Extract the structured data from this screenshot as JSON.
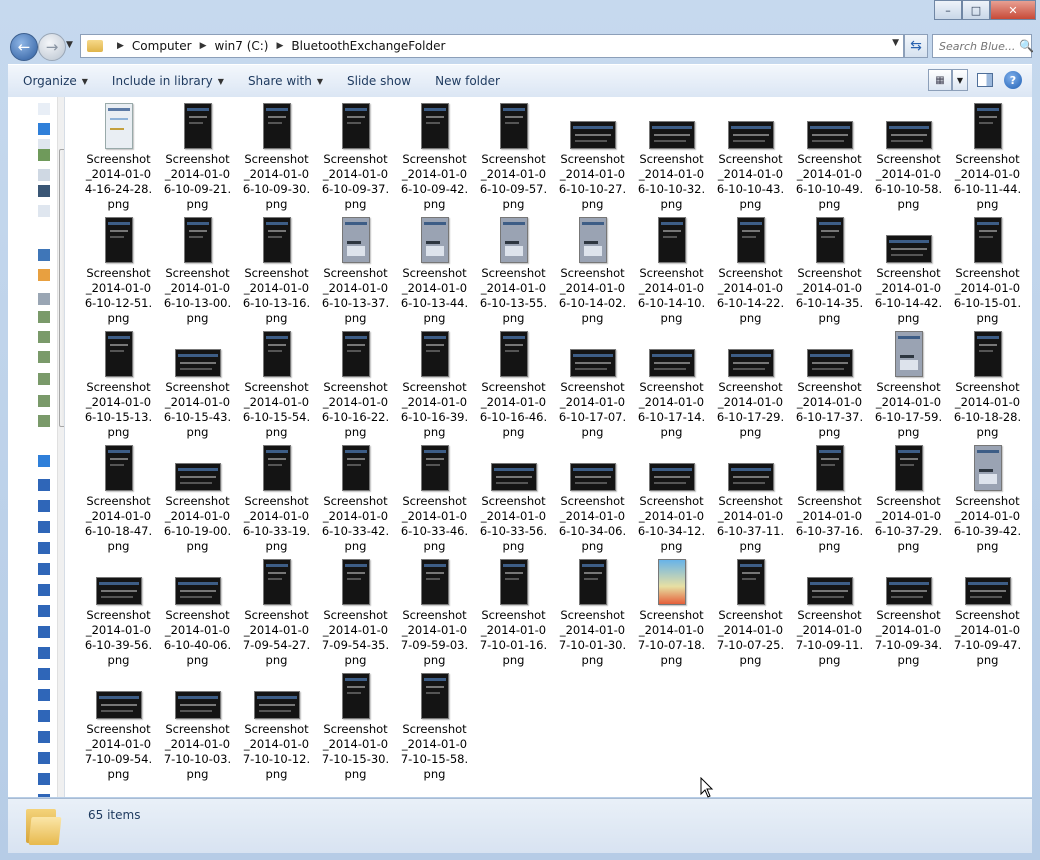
{
  "window": {
    "caption_buttons": [
      "minimize",
      "maximize",
      "close"
    ]
  },
  "address": {
    "path": [
      "Computer",
      "win7 (C:)",
      "BluetoothExchangeFolder"
    ],
    "search_placeholder": "Search Blue..."
  },
  "toolbar": {
    "items": [
      {
        "label": "Organize",
        "dropdown": true
      },
      {
        "label": "Include in library",
        "dropdown": true
      },
      {
        "label": "Share with",
        "dropdown": true
      },
      {
        "label": "Slide show",
        "dropdown": false
      },
      {
        "label": "New folder",
        "dropdown": false
      }
    ],
    "help": "?"
  },
  "files": [
    {
      "line1": "Screenshot",
      "line2": "_2014-01-0",
      "line3": "4-16-24-28.",
      "line4": "png",
      "thumb": "map"
    },
    {
      "line1": "Screenshot",
      "line2": "_2014-01-0",
      "line3": "6-10-09-21.",
      "line4": "png",
      "thumb": "p"
    },
    {
      "line1": "Screenshot",
      "line2": "_2014-01-0",
      "line3": "6-10-09-30.",
      "line4": "png",
      "thumb": "p"
    },
    {
      "line1": "Screenshot",
      "line2": "_2014-01-0",
      "line3": "6-10-09-37.",
      "line4": "png",
      "thumb": "p"
    },
    {
      "line1": "Screenshot",
      "line2": "_2014-01-0",
      "line3": "6-10-09-42.",
      "line4": "png",
      "thumb": "p"
    },
    {
      "line1": "Screenshot",
      "line2": "_2014-01-0",
      "line3": "6-10-09-57.",
      "line4": "png",
      "thumb": "p"
    },
    {
      "line1": "Screenshot",
      "line2": "_2014-01-0",
      "line3": "6-10-10-27.",
      "line4": "png",
      "thumb": "l"
    },
    {
      "line1": "Screenshot",
      "line2": "_2014-01-0",
      "line3": "6-10-10-32.",
      "line4": "png",
      "thumb": "l"
    },
    {
      "line1": "Screenshot",
      "line2": "_2014-01-0",
      "line3": "6-10-10-43.",
      "line4": "png",
      "thumb": "l"
    },
    {
      "line1": "Screenshot",
      "line2": "_2014-01-0",
      "line3": "6-10-10-49.",
      "line4": "png",
      "thumb": "l"
    },
    {
      "line1": "Screenshot",
      "line2": "_2014-01-0",
      "line3": "6-10-10-58.",
      "line4": "png",
      "thumb": "l"
    },
    {
      "line1": "Screenshot",
      "line2": "_2014-01-0",
      "line3": "6-10-11-44.",
      "line4": "png",
      "thumb": "p"
    },
    {
      "line1": "Screenshot",
      "line2": "_2014-01-0",
      "line3": "6-10-12-51.",
      "line4": "png",
      "thumb": "p"
    },
    {
      "line1": "Screenshot",
      "line2": "_2014-01-0",
      "line3": "6-10-13-00.",
      "line4": "png",
      "thumb": "p"
    },
    {
      "line1": "Screenshot",
      "line2": "_2014-01-0",
      "line3": "6-10-13-16.",
      "line4": "png",
      "thumb": "p"
    },
    {
      "line1": "Screenshot",
      "line2": "_2014-01-0",
      "line3": "6-10-13-37.",
      "line4": "png",
      "thumb": "kb"
    },
    {
      "line1": "Screenshot",
      "line2": "_2014-01-0",
      "line3": "6-10-13-44.",
      "line4": "png",
      "thumb": "kb"
    },
    {
      "line1": "Screenshot",
      "line2": "_2014-01-0",
      "line3": "6-10-13-55.",
      "line4": "png",
      "thumb": "kb"
    },
    {
      "line1": "Screenshot",
      "line2": "_2014-01-0",
      "line3": "6-10-14-02.",
      "line4": "png",
      "thumb": "kb"
    },
    {
      "line1": "Screenshot",
      "line2": "_2014-01-0",
      "line3": "6-10-14-10.",
      "line4": "png",
      "thumb": "p"
    },
    {
      "line1": "Screenshot",
      "line2": "_2014-01-0",
      "line3": "6-10-14-22.",
      "line4": "png",
      "thumb": "p"
    },
    {
      "line1": "Screenshot",
      "line2": "_2014-01-0",
      "line3": "6-10-14-35.",
      "line4": "png",
      "thumb": "p"
    },
    {
      "line1": "Screenshot",
      "line2": "_2014-01-0",
      "line3": "6-10-14-42.",
      "line4": "png",
      "thumb": "l"
    },
    {
      "line1": "Screenshot",
      "line2": "_2014-01-0",
      "line3": "6-10-15-01.",
      "line4": "png",
      "thumb": "p"
    },
    {
      "line1": "Screenshot",
      "line2": "_2014-01-0",
      "line3": "6-10-15-13.",
      "line4": "png",
      "thumb": "p"
    },
    {
      "line1": "Screenshot",
      "line2": "_2014-01-0",
      "line3": "6-10-15-43.",
      "line4": "png",
      "thumb": "l"
    },
    {
      "line1": "Screenshot",
      "line2": "_2014-01-0",
      "line3": "6-10-15-54.",
      "line4": "png",
      "thumb": "p"
    },
    {
      "line1": "Screenshot",
      "line2": "_2014-01-0",
      "line3": "6-10-16-22.",
      "line4": "png",
      "thumb": "p"
    },
    {
      "line1": "Screenshot",
      "line2": "_2014-01-0",
      "line3": "6-10-16-39.",
      "line4": "png",
      "thumb": "p"
    },
    {
      "line1": "Screenshot",
      "line2": "_2014-01-0",
      "line3": "6-10-16-46.",
      "line4": "png",
      "thumb": "p"
    },
    {
      "line1": "Screenshot",
      "line2": "_2014-01-0",
      "line3": "6-10-17-07.",
      "line4": "png",
      "thumb": "l"
    },
    {
      "line1": "Screenshot",
      "line2": "_2014-01-0",
      "line3": "6-10-17-14.",
      "line4": "png",
      "thumb": "l"
    },
    {
      "line1": "Screenshot",
      "line2": "_2014-01-0",
      "line3": "6-10-17-29.",
      "line4": "png",
      "thumb": "l"
    },
    {
      "line1": "Screenshot",
      "line2": "_2014-01-0",
      "line3": "6-10-17-37.",
      "line4": "png",
      "thumb": "l"
    },
    {
      "line1": "Screenshot",
      "line2": "_2014-01-0",
      "line3": "6-10-17-59.",
      "line4": "png",
      "thumb": "kb"
    },
    {
      "line1": "Screenshot",
      "line2": "_2014-01-0",
      "line3": "6-10-18-28.",
      "line4": "png",
      "thumb": "p"
    },
    {
      "line1": "Screenshot",
      "line2": "_2014-01-0",
      "line3": "6-10-18-47.",
      "line4": "png",
      "thumb": "p"
    },
    {
      "line1": "Screenshot",
      "line2": "_2014-01-0",
      "line3": "6-10-19-00.",
      "line4": "png",
      "thumb": "l"
    },
    {
      "line1": "Screenshot",
      "line2": "_2014-01-0",
      "line3": "6-10-33-19.",
      "line4": "png",
      "thumb": "p"
    },
    {
      "line1": "Screenshot",
      "line2": "_2014-01-0",
      "line3": "6-10-33-42.",
      "line4": "png",
      "thumb": "p"
    },
    {
      "line1": "Screenshot",
      "line2": "_2014-01-0",
      "line3": "6-10-33-46.",
      "line4": "png",
      "thumb": "p"
    },
    {
      "line1": "Screenshot",
      "line2": "_2014-01-0",
      "line3": "6-10-33-56.",
      "line4": "png",
      "thumb": "l"
    },
    {
      "line1": "Screenshot",
      "line2": "_2014-01-0",
      "line3": "6-10-34-06.",
      "line4": "png",
      "thumb": "l"
    },
    {
      "line1": "Screenshot",
      "line2": "_2014-01-0",
      "line3": "6-10-34-12.",
      "line4": "png",
      "thumb": "l"
    },
    {
      "line1": "Screenshot",
      "line2": "_2014-01-0",
      "line3": "6-10-37-11.",
      "line4": "png",
      "thumb": "l"
    },
    {
      "line1": "Screenshot",
      "line2": "_2014-01-0",
      "line3": "6-10-37-16.",
      "line4": "png",
      "thumb": "p"
    },
    {
      "line1": "Screenshot",
      "line2": "_2014-01-0",
      "line3": "6-10-37-29.",
      "line4": "png",
      "thumb": "p"
    },
    {
      "line1": "Screenshot",
      "line2": "_2014-01-0",
      "line3": "6-10-39-42.",
      "line4": "png",
      "thumb": "kb"
    },
    {
      "line1": "Screenshot",
      "line2": "_2014-01-0",
      "line3": "6-10-39-56.",
      "line4": "png",
      "thumb": "l"
    },
    {
      "line1": "Screenshot",
      "line2": "_2014-01-0",
      "line3": "6-10-40-06.",
      "line4": "png",
      "thumb": "l"
    },
    {
      "line1": "Screenshot",
      "line2": "_2014-01-0",
      "line3": "7-09-54-27.",
      "line4": "png",
      "thumb": "p"
    },
    {
      "line1": "Screenshot",
      "line2": "_2014-01-0",
      "line3": "7-09-54-35.",
      "line4": "png",
      "thumb": "p"
    },
    {
      "line1": "Screenshot",
      "line2": "_2014-01-0",
      "line3": "7-09-59-03.",
      "line4": "png",
      "thumb": "p"
    },
    {
      "line1": "Screenshot",
      "line2": "_2014-01-0",
      "line3": "7-10-01-16.",
      "line4": "png",
      "thumb": "p"
    },
    {
      "line1": "Screenshot",
      "line2": "_2014-01-0",
      "line3": "7-10-01-30.",
      "line4": "png",
      "thumb": "p"
    },
    {
      "line1": "Screenshot",
      "line2": "_2014-01-0",
      "line3": "7-10-07-18.",
      "line4": "png",
      "thumb": "home"
    },
    {
      "line1": "Screenshot",
      "line2": "_2014-01-0",
      "line3": "7-10-07-25.",
      "line4": "png",
      "thumb": "p"
    },
    {
      "line1": "Screenshot",
      "line2": "_2014-01-0",
      "line3": "7-10-09-11.",
      "line4": "png",
      "thumb": "l"
    },
    {
      "line1": "Screenshot",
      "line2": "_2014-01-0",
      "line3": "7-10-09-34.",
      "line4": "png",
      "thumb": "l"
    },
    {
      "line1": "Screenshot",
      "line2": "_2014-01-0",
      "line3": "7-10-09-47.",
      "line4": "png",
      "thumb": "l"
    },
    {
      "line1": "Screenshot",
      "line2": "_2014-01-0",
      "line3": "7-10-09-54.",
      "line4": "png",
      "thumb": "l"
    },
    {
      "line1": "Screenshot",
      "line2": "_2014-01-0",
      "line3": "7-10-10-03.",
      "line4": "png",
      "thumb": "l"
    },
    {
      "line1": "Screenshot",
      "line2": "_2014-01-0",
      "line3": "7-10-10-12.",
      "line4": "png",
      "thumb": "l"
    },
    {
      "line1": "Screenshot",
      "line2": "_2014-01-0",
      "line3": "7-10-15-30.",
      "line4": "png",
      "thumb": "p"
    },
    {
      "line1": "Screenshot",
      "line2": "_2014-01-0",
      "line3": "7-10-15-58.",
      "line4": "png",
      "thumb": "p"
    }
  ],
  "status": {
    "item_count": "65 items"
  }
}
